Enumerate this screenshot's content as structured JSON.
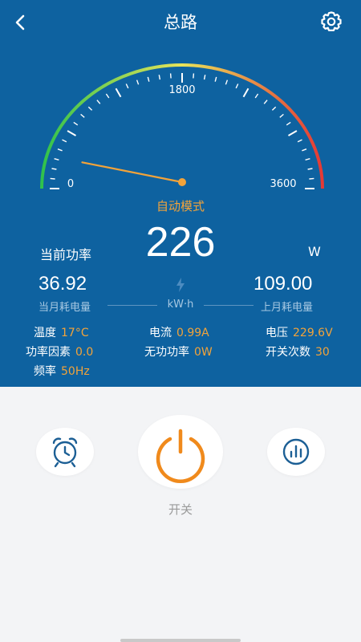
{
  "header": {
    "title": "总路"
  },
  "gauge": {
    "min_label": "0",
    "mid_label": "1800",
    "max_label": "3600",
    "max": 3600,
    "value": 226
  },
  "mode": "自动模式",
  "power": {
    "label": "当前功率",
    "value": "226",
    "unit": "W"
  },
  "energy": {
    "this_month_value": "36.92",
    "this_month_label": "当月耗电量",
    "unit": "kW·h",
    "last_month_value": "109.00",
    "last_month_label": "上月耗电量"
  },
  "params": {
    "temperature": {
      "label": "温度",
      "value": "17°C"
    },
    "current": {
      "label": "电流",
      "value": "0.99A"
    },
    "voltage": {
      "label": "电压",
      "value": "229.6V"
    },
    "power_factor": {
      "label": "功率因素",
      "value": "0.0"
    },
    "reactive_power": {
      "label": "无功功率",
      "value": "0W"
    },
    "switch_count": {
      "label": "开关次数",
      "value": "30"
    },
    "frequency": {
      "label": "频率",
      "value": "50Hz"
    }
  },
  "controls": {
    "switch_label": "开关"
  },
  "colors": {
    "header_bg": "#0e62a0",
    "accent": "#f2a33a",
    "power_button": "#f08a1c",
    "icon_blue": "#1c5f95",
    "gauge_start": "#2fc24c",
    "gauge_mid": "#e9e45a",
    "gauge_end": "#e53935"
  }
}
